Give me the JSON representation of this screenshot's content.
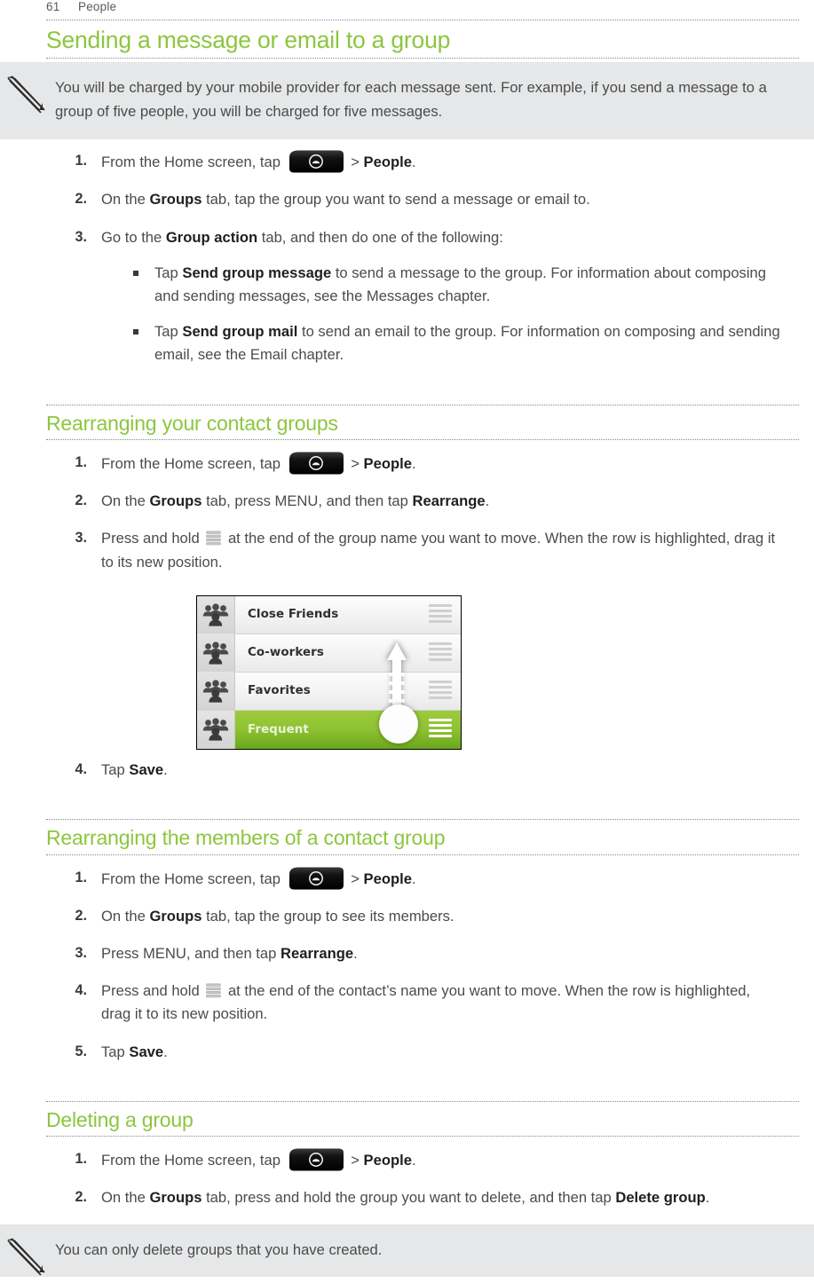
{
  "header": {
    "page_number": "61",
    "chapter": "People"
  },
  "sections": [
    {
      "id": "sending",
      "heading": "Sending a message or email to a group",
      "note": "You will be charged by your mobile provider for each message sent. For example, if you send a message to a group of five people, you will be charged for five messages.",
      "steps": [
        {
          "num": "1.",
          "parts": [
            {
              "t": "text",
              "v": "From the Home screen, tap "
            },
            {
              "t": "icon",
              "v": "home-button-icon"
            },
            {
              "t": "text",
              "v": " > "
            },
            {
              "t": "bold",
              "v": "People"
            },
            {
              "t": "text",
              "v": "."
            }
          ]
        },
        {
          "num": "2.",
          "parts": [
            {
              "t": "text",
              "v": "On the "
            },
            {
              "t": "bold",
              "v": "Groups"
            },
            {
              "t": "text",
              "v": " tab, tap the group you want to send a message or email to."
            }
          ]
        },
        {
          "num": "3.",
          "parts": [
            {
              "t": "text",
              "v": "Go to the "
            },
            {
              "t": "bold",
              "v": "Group action"
            },
            {
              "t": "text",
              "v": " tab, and then do one of the following:"
            }
          ],
          "bullets": [
            [
              {
                "t": "text",
                "v": "Tap "
              },
              {
                "t": "bold",
                "v": "Send group message"
              },
              {
                "t": "text",
                "v": " to send a message to the group. For information about composing and sending messages, see the Messages chapter."
              }
            ],
            [
              {
                "t": "text",
                "v": "Tap "
              },
              {
                "t": "bold",
                "v": "Send group mail"
              },
              {
                "t": "text",
                "v": " to send an email to the group. For information on composing and sending email, see the Email chapter."
              }
            ]
          ]
        }
      ]
    },
    {
      "id": "rearranging-groups",
      "heading": "Rearranging your contact groups",
      "steps": [
        {
          "num": "1.",
          "parts": [
            {
              "t": "text",
              "v": "From the Home screen, tap "
            },
            {
              "t": "icon",
              "v": "home-button-icon"
            },
            {
              "t": "text",
              "v": " > "
            },
            {
              "t": "bold",
              "v": "People"
            },
            {
              "t": "text",
              "v": "."
            }
          ]
        },
        {
          "num": "2.",
          "parts": [
            {
              "t": "text",
              "v": "On the "
            },
            {
              "t": "bold",
              "v": "Groups"
            },
            {
              "t": "text",
              "v": " tab, press MENU, and then tap "
            },
            {
              "t": "bold",
              "v": "Rearrange"
            },
            {
              "t": "text",
              "v": "."
            }
          ]
        },
        {
          "num": "3.",
          "parts": [
            {
              "t": "text",
              "v": "Press and hold "
            },
            {
              "t": "draghandle",
              "v": "drag-handle-icon"
            },
            {
              "t": "text",
              "v": " at the end of the group name you want to move. When the row is highlighted, drag it to its new position."
            }
          ]
        },
        {
          "num": "4.",
          "after_figure": true,
          "parts": [
            {
              "t": "text",
              "v": "Tap "
            },
            {
              "t": "bold",
              "v": "Save"
            },
            {
              "t": "text",
              "v": "."
            }
          ]
        }
      ],
      "figure": {
        "name": "contact-groups-rearrange-screenshot",
        "rows": [
          {
            "label": "Close Friends",
            "highlighted": false
          },
          {
            "label": "Co-workers",
            "highlighted": false
          },
          {
            "label": "Favorites",
            "highlighted": false
          },
          {
            "label": "Frequent",
            "highlighted": true
          }
        ],
        "highlight_color": "#8fc233"
      }
    },
    {
      "id": "rearranging-members",
      "heading": "Rearranging the members of a contact group",
      "steps": [
        {
          "num": "1.",
          "parts": [
            {
              "t": "text",
              "v": "From the Home screen, tap "
            },
            {
              "t": "icon",
              "v": "home-button-icon"
            },
            {
              "t": "text",
              "v": " > "
            },
            {
              "t": "bold",
              "v": "People"
            },
            {
              "t": "text",
              "v": "."
            }
          ]
        },
        {
          "num": "2.",
          "parts": [
            {
              "t": "text",
              "v": "On the "
            },
            {
              "t": "bold",
              "v": "Groups"
            },
            {
              "t": "text",
              "v": " tab, tap the group to see its members."
            }
          ]
        },
        {
          "num": "3.",
          "parts": [
            {
              "t": "text",
              "v": "Press MENU, and then tap "
            },
            {
              "t": "bold",
              "v": "Rearrange"
            },
            {
              "t": "text",
              "v": "."
            }
          ]
        },
        {
          "num": "4.",
          "parts": [
            {
              "t": "text",
              "v": "Press and hold "
            },
            {
              "t": "draghandle",
              "v": "drag-handle-icon"
            },
            {
              "t": "text",
              "v": " at the end of the contact’s name you want to move. When the row is highlighted, drag it to its new position."
            }
          ]
        },
        {
          "num": "5.",
          "parts": [
            {
              "t": "text",
              "v": "Tap "
            },
            {
              "t": "bold",
              "v": "Save"
            },
            {
              "t": "text",
              "v": "."
            }
          ]
        }
      ]
    },
    {
      "id": "deleting-group",
      "heading": "Deleting a group",
      "steps": [
        {
          "num": "1.",
          "parts": [
            {
              "t": "text",
              "v": "From the Home screen, tap "
            },
            {
              "t": "icon",
              "v": "home-button-icon"
            },
            {
              "t": "text",
              "v": " > "
            },
            {
              "t": "bold",
              "v": "People"
            },
            {
              "t": "text",
              "v": "."
            }
          ]
        },
        {
          "num": "2.",
          "parts": [
            {
              "t": "text",
              "v": "On the "
            },
            {
              "t": "bold",
              "v": "Groups"
            },
            {
              "t": "text",
              "v": " tab, press and hold the group you want to delete, and then tap "
            },
            {
              "t": "bold",
              "v": "Delete group"
            },
            {
              "t": "text",
              "v": "."
            }
          ]
        }
      ],
      "note": "You can only delete groups that you have created."
    }
  ],
  "colors": {
    "heading_green": "#8cc63f",
    "note_background": "#e6e7e8",
    "body_text": "#4b4b4b",
    "bold_text": "#1f1f1f"
  },
  "icons": {
    "note": "pencil-icon",
    "home_button": "home-app-launcher-icon",
    "drag_handle": "drag-handle-icon"
  }
}
